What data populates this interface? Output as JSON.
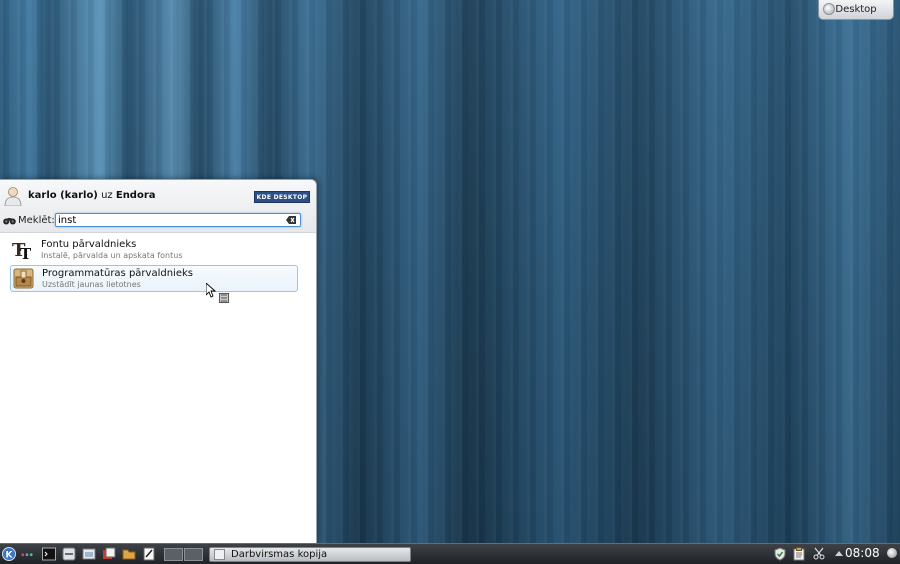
{
  "desktop": {
    "activity_label": "Desktop"
  },
  "launcher": {
    "user_name": "karlo (karlo)",
    "user_connector": "uz",
    "host": "Endora",
    "logo_text": "KDE DESKTOP",
    "search": {
      "label": "Meklēt:",
      "value": "inst"
    },
    "results": [
      {
        "title": "Fontu pārvaldnieks",
        "subtitle": "Instalē, pārvalda un apskata fontus",
        "icon": "font-manager-icon"
      },
      {
        "title": "Programmatūras pārvaldnieks",
        "subtitle": "Uzstādīt jaunas lietotnes",
        "icon": "package-manager-icon"
      }
    ]
  },
  "taskbar": {
    "task_label": "Darbvirsmas kopija",
    "clock": "08:08"
  },
  "colors": {
    "accent": "#4a90d9",
    "taskbar": "#2b2f33",
    "wallpaper": "#2c5a7c"
  }
}
